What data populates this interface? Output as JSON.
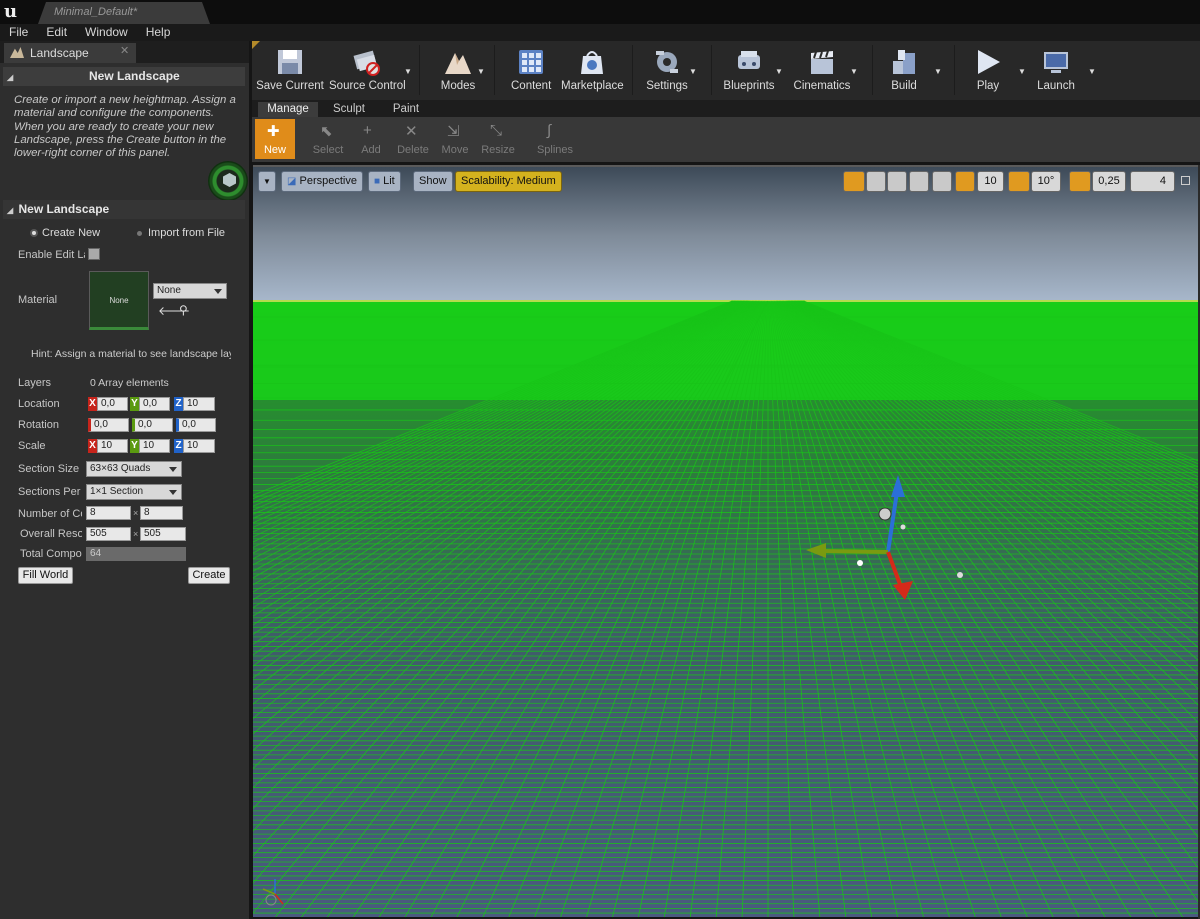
{
  "window": {
    "doc_tab": "Minimal_Default*"
  },
  "menu": [
    "File",
    "Edit",
    "Window",
    "Help"
  ],
  "left_panel": {
    "tab_label": "Landscape",
    "section1_title": "New Landscape",
    "help_text": "Create or import a new heightmap. Assign a material and configure the components. When you are ready to create your new Landscape, press the Create button in the lower-right corner of this panel.",
    "section2_title": "New Landscape",
    "radio_create": "Create New",
    "radio_import": "Import from File",
    "enable_edit_layers": "Enable Edit Lay",
    "material_label": "Material",
    "material_thumb": "None",
    "material_dropdown": "None",
    "hint": "Hint: Assign a material to see landscape laye",
    "layers_label": "Layers",
    "layers_value": "0 Array elements",
    "location_label": "Location",
    "location": {
      "x": "0,0",
      "y": "0,0",
      "z": "10"
    },
    "rotation_label": "Rotation",
    "rotation": {
      "x": "0,0",
      "y": "0,0",
      "z": "0,0"
    },
    "scale_label": "Scale",
    "scale": {
      "x": "10",
      "y": "10",
      "z": "10"
    },
    "axis": {
      "x": "X",
      "y": "Y",
      "z": "Z"
    },
    "section_size_label": "Section Size",
    "section_size": "63×63 Quads",
    "sections_per_label": "Sections Per C",
    "sections_per": "1×1 Section",
    "number_of_label": "Number of Cor",
    "number_of": {
      "a": "8",
      "b": "8"
    },
    "overall_label": "Overall Resol",
    "overall": {
      "a": "505",
      "b": "505"
    },
    "times": "×",
    "total_label": "Total Compor",
    "total_value": "64",
    "fill_world": "Fill World",
    "create": "Create"
  },
  "toolbar": {
    "save_current": "Save Current",
    "source_control": "Source Control",
    "modes": "Modes",
    "content": "Content",
    "marketplace": "Marketplace",
    "settings": "Settings",
    "blueprints": "Blueprints",
    "cinematics": "Cinematics",
    "build": "Build",
    "play": "Play",
    "launch": "Launch"
  },
  "mode_tabs": [
    "Manage",
    "Sculpt",
    "Paint"
  ],
  "tools": {
    "new": "New",
    "select": "Select",
    "add": "Add",
    "delete": "Delete",
    "move": "Move",
    "resize": "Resize",
    "splines": "Splines"
  },
  "viewport": {
    "perspective": "Perspective",
    "lit": "Lit",
    "show": "Show",
    "scalability": "Scalability: Medium",
    "grid_snap": "10",
    "rotation_snap": "10°",
    "scale_snap": "0,25",
    "camera_speed": "4",
    "colors": {
      "ground": "#17d417",
      "sky": "#7e8a98",
      "floor": "#4a5a7a"
    }
  }
}
